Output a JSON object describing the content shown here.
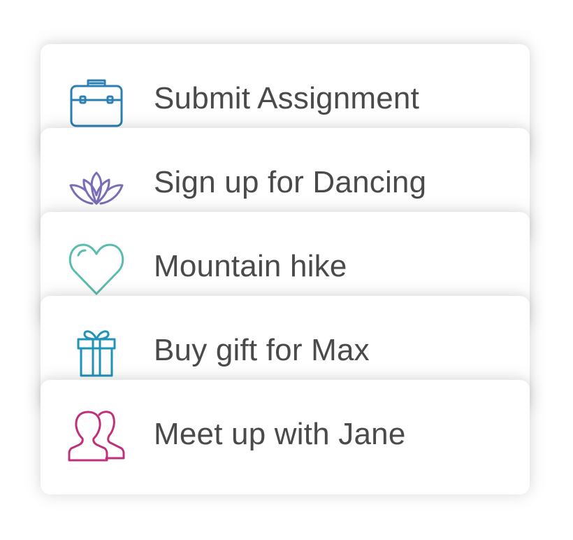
{
  "tasks": [
    {
      "label": "Submit Assignment",
      "icon": "briefcase-icon",
      "color": "#2b7fb3"
    },
    {
      "label": "Sign up for Dancing",
      "icon": "lotus-icon",
      "color": "#7b6cb7"
    },
    {
      "label": "Mountain hike",
      "icon": "heart-icon",
      "color": "#5bbcae"
    },
    {
      "label": "Buy gift for Max",
      "icon": "gift-icon",
      "color": "#1f93b8"
    },
    {
      "label": "Meet up with Jane",
      "icon": "people-icon",
      "color": "#c0307a"
    }
  ]
}
